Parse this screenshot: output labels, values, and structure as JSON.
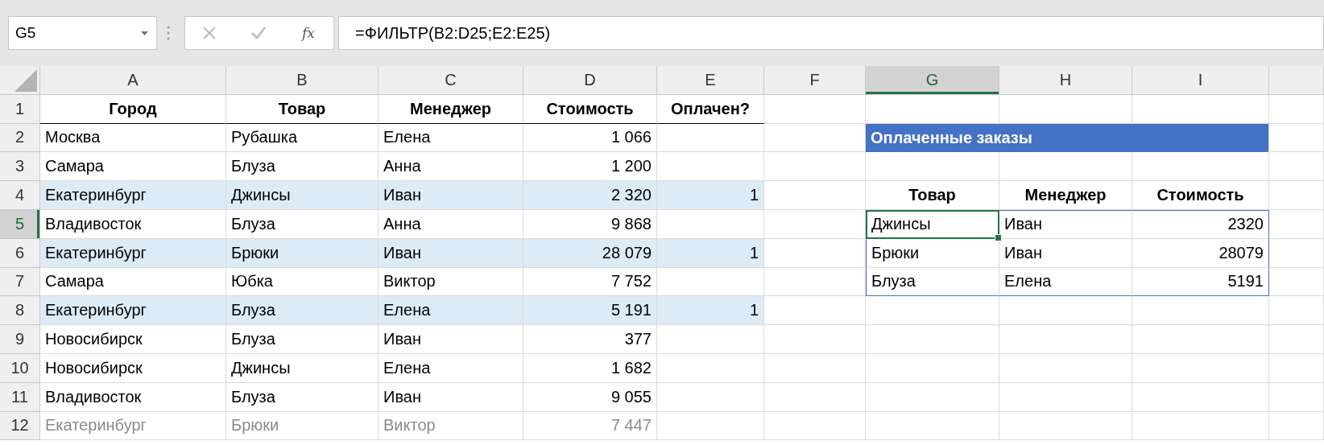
{
  "formula_bar": {
    "name_box": "G5",
    "function_label": "fx",
    "formula": "=ФИЛЬТР(B2:D25;E2:E25)"
  },
  "columns": [
    {
      "label": "A",
      "selected": false
    },
    {
      "label": "B",
      "selected": false
    },
    {
      "label": "C",
      "selected": false
    },
    {
      "label": "D",
      "selected": false
    },
    {
      "label": "E",
      "selected": false
    },
    {
      "label": "F",
      "selected": false
    },
    {
      "label": "G",
      "selected": true
    },
    {
      "label": "H",
      "selected": false
    },
    {
      "label": "I",
      "selected": false
    }
  ],
  "row_headers": [
    {
      "label": "1",
      "selected": false
    },
    {
      "label": "2",
      "selected": false
    },
    {
      "label": "3",
      "selected": false
    },
    {
      "label": "4",
      "selected": false
    },
    {
      "label": "5",
      "selected": true
    },
    {
      "label": "6",
      "selected": false
    },
    {
      "label": "7",
      "selected": false
    },
    {
      "label": "8",
      "selected": false
    },
    {
      "label": "9",
      "selected": false
    },
    {
      "label": "10",
      "selected": false
    },
    {
      "label": "11",
      "selected": false
    },
    {
      "label": "12",
      "selected": false
    }
  ],
  "table": {
    "columns": [
      "Город",
      "Товар",
      "Менеджер",
      "Стоимость",
      "Оплачен?"
    ],
    "rows": [
      {
        "cells": [
          "Москва",
          "Рубашка",
          "Елена",
          "1 066"
        ],
        "highlighted": false
      },
      {
        "cells": [
          "Самара",
          "Блуза",
          "Анна",
          "1 200"
        ],
        "highlighted": false
      },
      {
        "cells": [
          "Екатеринбург",
          "Джинсы",
          "Иван",
          "2 320",
          "1"
        ],
        "highlighted": true
      },
      {
        "cells": [
          "Владивосток",
          "Блуза",
          "Анна",
          "9 868"
        ],
        "highlighted": false
      },
      {
        "cells": [
          "Екатеринбург",
          "Брюки",
          "Иван",
          "28 079",
          "1"
        ],
        "highlighted": true
      },
      {
        "cells": [
          "Самара",
          "Юбка",
          "Виктор",
          "7 752"
        ],
        "highlighted": false
      },
      {
        "cells": [
          "Екатеринбург",
          "Блуза",
          "Елена",
          "5 191",
          "1"
        ],
        "highlighted": true
      },
      {
        "cells": [
          "Новосибирск",
          "Блуза",
          "Иван",
          "377"
        ],
        "highlighted": false
      },
      {
        "cells": [
          "Новосибирск",
          "Джинсы",
          "Елена",
          "1 682"
        ],
        "highlighted": false
      },
      {
        "cells": [
          "Владивосток",
          "Блуза",
          "Иван",
          "9 055"
        ],
        "highlighted": false
      },
      {
        "cells": [
          "Екатеринбург",
          "Брюки",
          "Виктор",
          "7 447"
        ],
        "highlighted": false
      }
    ]
  },
  "result": {
    "title": "Оплаченные заказы",
    "columns": [
      "Товар",
      "Менеджер",
      "Стоимость"
    ],
    "rows": [
      {
        "cells": [
          {
            "text": "Джинсы",
            "selected": true
          },
          {
            "text": "Иван",
            "selected": false
          },
          {
            "text": "2320",
            "selected": false
          }
        ]
      },
      {
        "cells": [
          {
            "text": "Брюки",
            "selected": false
          },
          {
            "text": "Иван",
            "selected": false
          },
          {
            "text": "28079",
            "selected": false
          }
        ]
      },
      {
        "cells": [
          {
            "text": "Блуза",
            "selected": false
          },
          {
            "text": "Елена",
            "selected": false
          },
          {
            "text": "5191",
            "selected": false
          }
        ]
      }
    ]
  }
}
